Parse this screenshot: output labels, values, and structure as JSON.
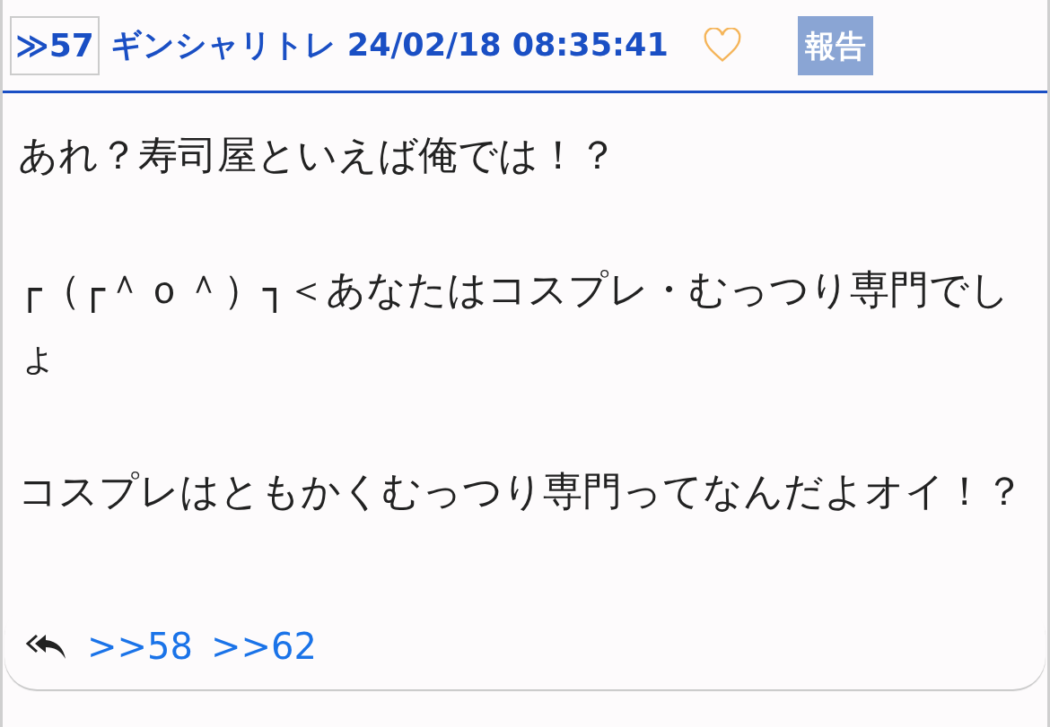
{
  "post": {
    "number": "≫57",
    "name": "ギンシャリトレ",
    "date": "24/02/18 08:35:41",
    "liked": false,
    "report": "報告"
  },
  "body": [
    "あれ？寿司屋といえば俺では！？",
    "┌（┌＾ｏ＾）┐＜あなたはコスプレ・むっつり専門でしょ",
    "コスプレはともかくむっつり専門ってなんだよオイ！？"
  ],
  "replies": [
    ">>58",
    ">>62"
  ]
}
